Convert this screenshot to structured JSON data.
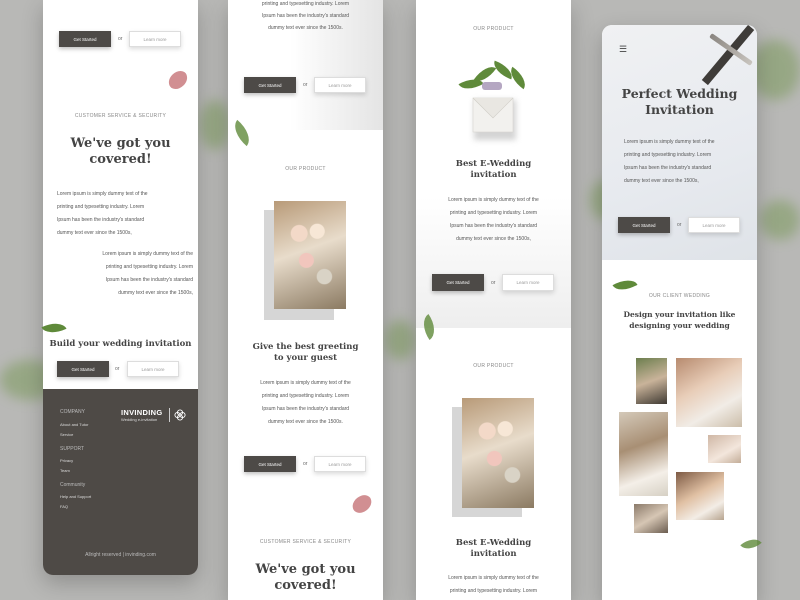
{
  "common": {
    "get_started": "Get Started",
    "or": "or",
    "learn_more": "Learn more",
    "lorem_1": "Lorem ipsum is simply dummy text of the",
    "lorem_2": "printing and typesetting industry. Lorem",
    "lorem_3": "Ipsum has been the industry's standard",
    "lorem_4": "dummy text ever since the 1500s,",
    "lorem_4b": "dummy text ever since the 1500s.",
    "our_product": "OUR PRODUCT",
    "customer_service": "CUSTOMER SERVICE & SECURITY",
    "covered_1": "We've got you",
    "covered_2": "covered!"
  },
  "screen1": {
    "build_title": "Build your wedding invitation",
    "footer": {
      "brand": "INVINDING",
      "brand_sub": "Wedding e-invitation",
      "company_heading": "COMPANY",
      "company_links": [
        "About and Tutor",
        "Service"
      ],
      "support_heading": "SUPPORT",
      "support_links": [
        "Privacy",
        "Team"
      ],
      "community_heading": "Community",
      "community_links": [
        "Help and Support",
        "FAQ"
      ],
      "copyright": "Allright reserved | invinding.com"
    }
  },
  "screen2": {
    "greeting_1": "Give the best greeting",
    "greeting_2": "to your guest"
  },
  "screen3": {
    "title_1": "Best E-Wedding",
    "title_2": "invitation"
  },
  "screen4": {
    "menu_icon": "☰",
    "hero_1": "Perfect Wedding",
    "hero_2": "Invitation",
    "client_tag": "OUR CLIENT WEDDING",
    "client_1": "Design your invitation like",
    "client_2": "designing your wedding"
  }
}
